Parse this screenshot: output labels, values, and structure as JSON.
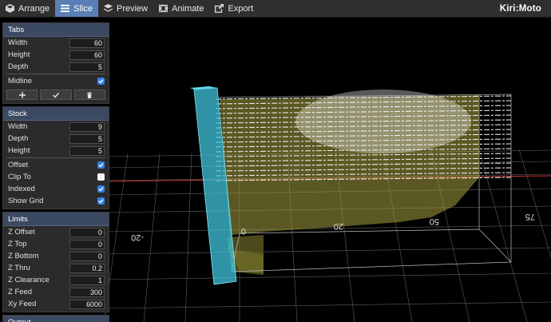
{
  "nav": {
    "arrange": "Arrange",
    "slice": "Slice",
    "preview": "Preview",
    "animate": "Animate",
    "export": "Export"
  },
  "brand": "Kiri:Moto",
  "tabs": {
    "title": "Tabs",
    "width_label": "Width",
    "width_value": "60",
    "height_label": "Height",
    "height_value": "60",
    "depth_label": "Depth",
    "depth_value": "5",
    "midline_label": "Midline",
    "midline_checked": true
  },
  "stock": {
    "title": "Stock",
    "width_label": "Width",
    "width_value": "9",
    "depth_label": "Depth",
    "depth_value": "5",
    "height_label": "Height",
    "height_value": "5",
    "offset_label": "Offset",
    "offset_checked": true,
    "clipto_label": "Clip To",
    "clipto_checked": false,
    "indexed_label": "Indexed",
    "indexed_checked": true,
    "showgrid_label": "Show Grid",
    "showgrid_checked": true
  },
  "limits": {
    "title": "Limits",
    "zoffset_label": "Z Offset",
    "zoffset_value": "0",
    "ztop_label": "Z Top",
    "ztop_value": "0",
    "zbottom_label": "Z Bottom",
    "zbottom_value": "0",
    "zthru_label": "Z Thru",
    "zthru_value": "0.2",
    "zclear_label": "Z Clearance",
    "zclear_value": "1",
    "zfeed_label": "Z Feed",
    "zfeed_value": "300",
    "xyfeed_label": "Xy Feed",
    "xyfeed_value": "6000"
  },
  "output": {
    "title": "Output"
  },
  "viewport": {
    "tick_labels": [
      "-20",
      "0",
      "20",
      "50",
      "75"
    ]
  },
  "colors": {
    "accent": "#5a7fb5",
    "stock_box": "#3fc4dc",
    "part": "#a8a040",
    "grid": "#6a6a6a",
    "x_axis": "#c03030"
  }
}
